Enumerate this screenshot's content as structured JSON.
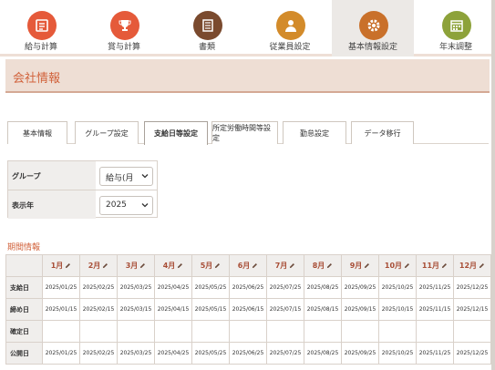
{
  "nav": {
    "items": [
      {
        "label": "給与計算",
        "icon": "payroll-icon",
        "color": "#e55a3a"
      },
      {
        "label": "賞与計算",
        "icon": "trophy-icon",
        "color": "#e55a3a"
      },
      {
        "label": "書類",
        "icon": "document-icon",
        "color": "#7a4a2e"
      },
      {
        "label": "従業員設定",
        "icon": "person-icon",
        "color": "#d38b2a"
      },
      {
        "label": "基本情報設定",
        "icon": "gear-icon",
        "color": "#c9702a",
        "active": true
      },
      {
        "label": "年末調整",
        "icon": "calendar-icon",
        "color": "#8da23a"
      }
    ]
  },
  "page": {
    "title": "会社情報"
  },
  "tabs": [
    {
      "label": "基本情報"
    },
    {
      "label": "グループ設定"
    },
    {
      "label": "支給日等設定",
      "active": true
    },
    {
      "label": "所定労働時間等設定"
    },
    {
      "label": "勤怠設定"
    },
    {
      "label": "データ移行"
    }
  ],
  "filter": {
    "group_label": "グループ",
    "group_value": "給与(月",
    "year_label": "表示年",
    "year_value": "2025"
  },
  "period": {
    "section_label": "期間情報",
    "months": [
      "1月",
      "2月",
      "3月",
      "4月",
      "5月",
      "6月",
      "7月",
      "8月",
      "9月",
      "10月",
      "11月",
      "12月"
    ],
    "rows": [
      {
        "label": "支給日",
        "values": [
          "2025/01/25",
          "2025/02/25",
          "2025/03/25",
          "2025/04/25",
          "2025/05/25",
          "2025/06/25",
          "2025/07/25",
          "2025/08/25",
          "2025/09/25",
          "2025/10/25",
          "2025/11/25",
          "2025/12/25"
        ]
      },
      {
        "label": "締め日",
        "values": [
          "2025/01/15",
          "2025/02/15",
          "2025/03/15",
          "2025/04/15",
          "2025/05/15",
          "2025/06/15",
          "2025/07/15",
          "2025/08/15",
          "2025/09/15",
          "2025/10/15",
          "2025/11/15",
          "2025/12/15"
        ]
      },
      {
        "label": "確定日",
        "values": [
          "",
          "",
          "",
          "",
          "",
          "",
          "",
          "",
          "",
          "",
          "",
          ""
        ]
      },
      {
        "label": "公開日",
        "values": [
          "2025/01/25",
          "2025/02/25",
          "2025/03/25",
          "2025/04/25",
          "2025/05/25",
          "2025/06/25",
          "2025/07/25",
          "2025/08/25",
          "2025/09/25",
          "2025/10/25",
          "2025/11/25",
          "2025/12/25"
        ]
      }
    ]
  }
}
